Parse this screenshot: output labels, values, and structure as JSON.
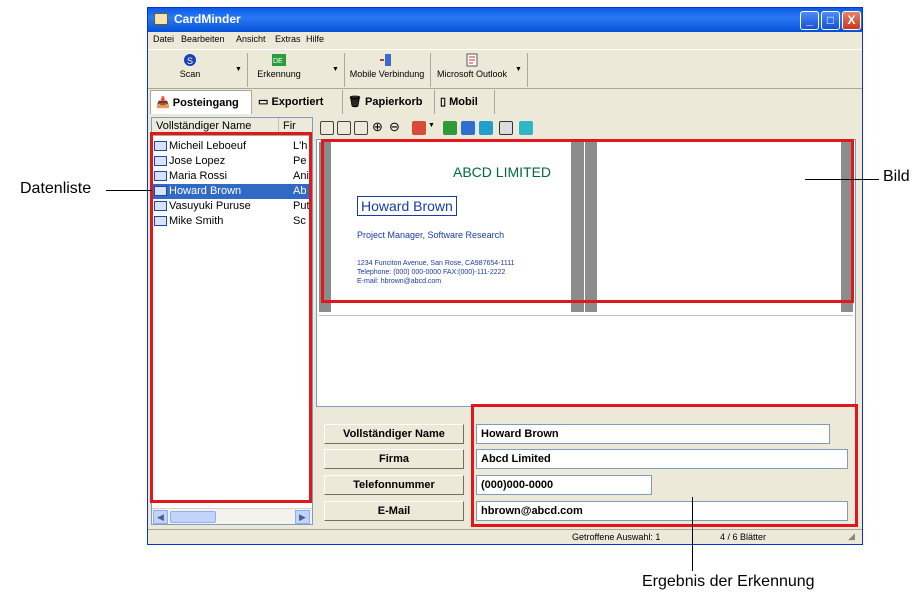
{
  "window": {
    "title": "CardMinder",
    "controls": [
      "_",
      "□",
      "X"
    ]
  },
  "menu": [
    "Datei",
    "Bearbeiten",
    "Ansicht",
    "Extras",
    "Hilfe"
  ],
  "toolbar": {
    "scan": "Scan",
    "erkennung": "Erkennung",
    "mobile": "Mobile Verbindung",
    "outlook": "Microsoft Outlook"
  },
  "tabs": [
    "Posteingang",
    "Exportiert",
    "Papierkorb",
    "Mobil"
  ],
  "list": {
    "col_name": "Vollständiger Name",
    "col_company": "Fir",
    "rows": [
      {
        "name": "Micheil Leboeuf",
        "company": "L'h",
        "selected": false
      },
      {
        "name": "Jose Lopez",
        "company": "Pe",
        "selected": false
      },
      {
        "name": "Maria Rossi",
        "company": "Ani",
        "selected": false
      },
      {
        "name": "Howard Brown",
        "company": "Ab",
        "selected": true
      },
      {
        "name": "Vasuyuki Puruse",
        "company": "Put",
        "selected": false
      },
      {
        "name": "Mike Smith",
        "company": "Sc",
        "selected": false
      }
    ]
  },
  "card": {
    "company": "ABCD LIMITED",
    "name": "Howard Brown",
    "title": "Project Manager, Software Research",
    "address": "1234 Funciton Avenue, San Rose, CA987654-1111",
    "phone": "Telephone: (000) 000-0000  FAX:(000)-111-2222",
    "email": "E-mail: hbrown@abcd.com"
  },
  "fields": [
    {
      "label": "Vollständiger Name",
      "value": "Howard Brown"
    },
    {
      "label": "Firma",
      "value": "Abcd Limited"
    },
    {
      "label": "Telefonnummer",
      "value": "(000)000-0000"
    },
    {
      "label": "E-Mail",
      "value": "hbrown@abcd.com"
    }
  ],
  "status": {
    "hits": "Getroffene Auswahl:  1",
    "pages": "4 /   6 Blätter"
  },
  "callouts": {
    "datenliste": "Datenliste",
    "bild": "Bild",
    "ergebnis": "Ergebnis der Erkennung"
  },
  "colors": {
    "highlight": "#e0181e",
    "selection": "#316ac5",
    "titlebar": "#0a5ce6"
  }
}
